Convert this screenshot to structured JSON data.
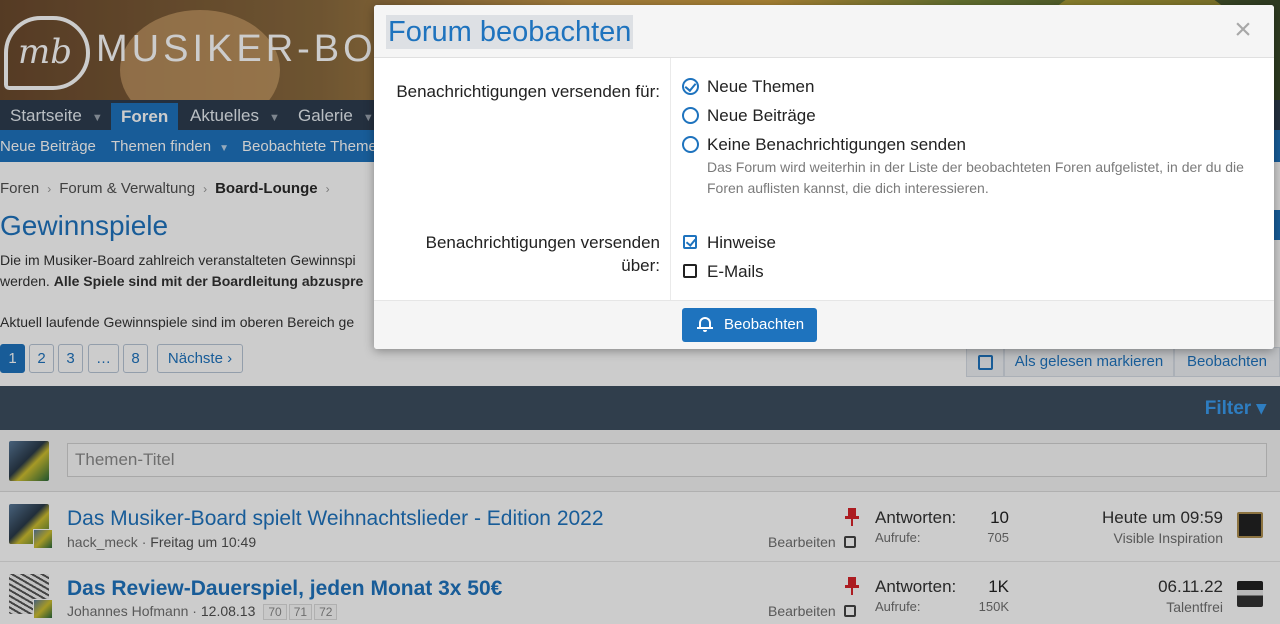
{
  "header": {
    "logo_mark": "mb",
    "logo_text": "MUSIKER-BOAR"
  },
  "nav": {
    "items": [
      {
        "label": "Startseite",
        "has_menu": true
      },
      {
        "label": "Foren",
        "active": true
      },
      {
        "label": "Aktuelles",
        "has_menu": true
      },
      {
        "label": "Galerie",
        "has_menu": true
      }
    ]
  },
  "subnav": {
    "items": [
      {
        "label": "Neue Beiträge"
      },
      {
        "label": "Themen finden",
        "has_menu": true
      },
      {
        "label": "Beobachtete Theme"
      }
    ]
  },
  "breadcrumb": [
    "Foren",
    "Forum & Verwaltung",
    "Board-Lounge"
  ],
  "forum": {
    "title": "Gewinnspiele",
    "desc_line1": "Die im Musiker-Board zahlreich veranstalteten Gewinnspi",
    "desc_line2_plain": "werden. ",
    "desc_line2_bold": "Alle Spiele sind mit der Boardleitung abzuspre",
    "desc_line3": "Aktuell laufende Gewinnspiele sind im oberen Bereich ge"
  },
  "pagination": {
    "pages": [
      "1",
      "2",
      "3",
      "…",
      "8"
    ],
    "current": "1",
    "next_label": "Nächste ›"
  },
  "actions": {
    "mark_read": "Als gelesen markieren",
    "watch": "Beobachten"
  },
  "filter": {
    "label": "Filter ▾"
  },
  "new_thread": {
    "placeholder": "Themen-Titel"
  },
  "threads": [
    {
      "title": "Das Musiker-Board spielt Weihnachtslieder - Edition 2022",
      "author": "hack_meck",
      "date": "Freitag um 10:49",
      "edit_label": "Bearbeiten",
      "replies_label": "Antworten:",
      "replies": "10",
      "views_label": "Aufrufe:",
      "views": "705",
      "last_date": "Heute um 09:59",
      "last_user": "Visible Inspiration",
      "pages": []
    },
    {
      "title": "Das Review-Dauerspiel, jeden Monat 3x 50€",
      "author": "Johannes Hofmann",
      "date": "12.08.13",
      "edit_label": "Bearbeiten",
      "replies_label": "Antworten:",
      "replies": "1K",
      "views_label": "Aufrufe:",
      "views": "150K",
      "last_date": "06.11.22",
      "last_user": "Talentfrei",
      "pages": [
        "70",
        "71",
        "72"
      ]
    }
  ],
  "modal": {
    "title": "Forum beobachten",
    "close_glyph": "×",
    "send_for_label": "Benachrichtigungen versenden für:",
    "send_for_options": [
      {
        "label": "Neue Themen",
        "selected": true
      },
      {
        "label": "Neue Beiträge",
        "selected": false
      },
      {
        "label": "Keine Benachrichtigungen senden",
        "selected": false
      }
    ],
    "no_notify_hint": "Das Forum wird weiterhin in der Liste der beobachteten Foren aufgelistet, in der du die Foren auflisten kannst, die dich interessieren.",
    "send_via_label_line1": "Benachrichtigungen versenden",
    "send_via_label_line2": "über:",
    "send_via_options": [
      {
        "label": "Hinweise",
        "checked": true
      },
      {
        "label": "E-Mails",
        "checked": false
      }
    ],
    "submit_label": "Beobachten",
    "submit_icon": "bell-icon"
  },
  "colors": {
    "accent": "#1e73be",
    "nav_bg": "#2d3d4f",
    "pin": "#d8232a"
  }
}
